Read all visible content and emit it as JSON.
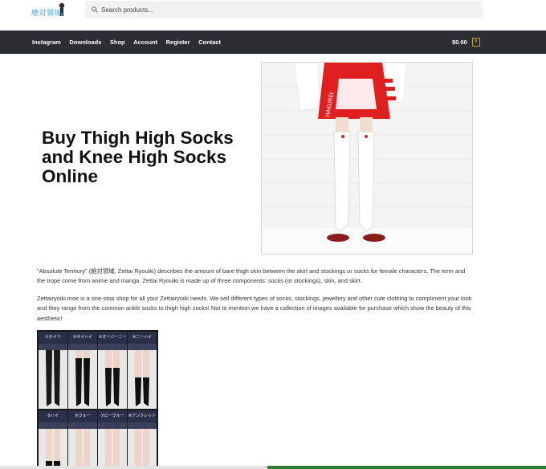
{
  "header": {
    "logo_text": "絶対領域",
    "search": {
      "placeholder": "Search products..."
    }
  },
  "nav": {
    "items": [
      "Instagram",
      "Downloads",
      "Shop",
      "Account",
      "Register",
      "Contact"
    ],
    "cart_total": "$0.00",
    "cart_count": "0"
  },
  "hero": {
    "title": "Buy Thigh High Socks and Knee High Socks Online",
    "image_print": "HAKUREI"
  },
  "content": {
    "paragraph1": "\"Absolute Territory\" (絶対領域, Zettai Ryouiki) describes the amount of bare thigh skin between the skirt and stockings or socks for female characters. The term and the trope come from anime and manga. Zettai Ryouiki is made up of three components: socks (or stockings), skin, and skirt.",
    "paragraph2": "Zettairyoiki.moe is a one-stop shop for all your Zettairyoiki needs. We sell different types of socks, stockings, jewellery and other cute clothing to compliment your look and they range from the common ankle socks to thigh high socks! Not to mention we have a collection of images available for purchase which show the beauty of this aesthetic!"
  },
  "sock_grid": {
    "labels": [
      "①タイツ",
      "②サイハイ",
      "③オーバーニー",
      "④ニーハイ",
      "⑤ハイ",
      "⑥クルー",
      "⑦ロークルー",
      "⑧アンクレット"
    ]
  },
  "colors": {
    "navbar": "#2c2d33",
    "accent": "#c9a227",
    "logo": "#3aa6e0",
    "bottom_progress": "#2e7d32"
  }
}
